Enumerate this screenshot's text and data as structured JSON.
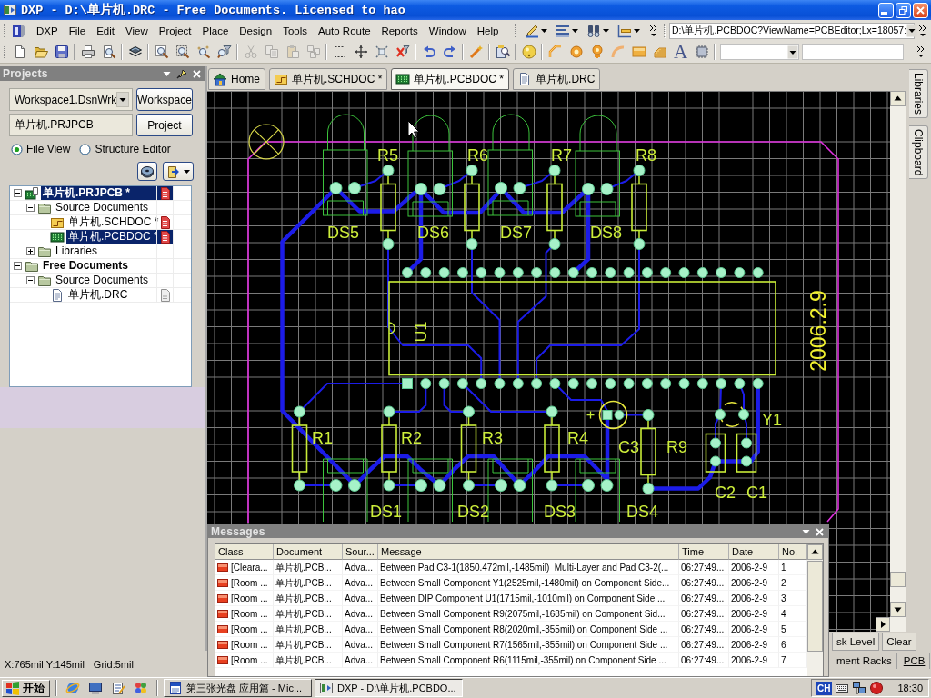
{
  "window": {
    "title": "DXP - D:\\单片机.DRC - Free Documents. Licensed to hao"
  },
  "menu_bar": {
    "items": [
      "DXP",
      "File",
      "Edit",
      "View",
      "Project",
      "Place",
      "Design",
      "Tools",
      "Auto Route",
      "Reports",
      "Window",
      "Help"
    ],
    "address": "D:\\单片机.PCBDOC?ViewName=PCBEditor;Lx=18057:"
  },
  "toolbar": {
    "clipboard_tools": [
      {
        "disabled": true
      },
      {
        "disabled": true
      },
      {
        "disabled": true
      },
      {
        "disabled": true
      }
    ],
    "text_tool": "A"
  },
  "projects_panel": {
    "title": "Projects",
    "workspace": {
      "value": "Workspace1.DsnWrk",
      "button": "Workspace"
    },
    "project": {
      "value": "单片机.PRJPCB",
      "button": "Project"
    },
    "view_options": [
      {
        "label": "File View",
        "selected": true
      },
      {
        "label": "Structure Editor",
        "selected": false
      }
    ],
    "tree": [
      {
        "label": "单片机.PRJPCB *",
        "kind": "project",
        "expanded": true,
        "selected": true,
        "modified": true,
        "children": [
          {
            "label": "Source Documents",
            "kind": "folder",
            "expanded": true,
            "selected": false,
            "children": [
              {
                "label": "单片机.SCHDOC *",
                "kind": "schematic",
                "selected": false,
                "modified": true
              },
              {
                "label": "单片机.PCBDOC *",
                "kind": "pcb",
                "selected": true,
                "modified": true
              }
            ]
          },
          {
            "label": "Libraries",
            "kind": "folder",
            "expanded": false,
            "selected": false
          }
        ]
      },
      {
        "label": "Free Documents",
        "kind": "group",
        "expanded": true,
        "selected": false,
        "children": [
          {
            "label": "Source Documents",
            "kind": "folder",
            "expanded": true,
            "selected": false,
            "children": [
              {
                "label": "单片机.DRC",
                "kind": "report",
                "selected": false,
                "modified": false
              }
            ]
          }
        ]
      }
    ]
  },
  "document_tabs": [
    {
      "label": "Home",
      "kind": "home",
      "selected": false
    },
    {
      "label": "单片机.SCHDOC *",
      "kind": "schematic",
      "selected": false
    },
    {
      "label": "单片机.PCBDOC *",
      "kind": "pcb",
      "selected": true
    },
    {
      "label": "单片机.DRC",
      "kind": "report",
      "selected": false
    }
  ],
  "side_tabs": [
    "Libraries",
    "Clipboard"
  ],
  "pcb": {
    "components": [
      {
        "designator": "R5",
        "kind": "resistor"
      },
      {
        "designator": "R6",
        "kind": "resistor"
      },
      {
        "designator": "R7",
        "kind": "resistor"
      },
      {
        "designator": "R8",
        "kind": "resistor"
      },
      {
        "designator": "DS5",
        "kind": "led"
      },
      {
        "designator": "DS6",
        "kind": "led"
      },
      {
        "designator": "DS7",
        "kind": "led"
      },
      {
        "designator": "DS8",
        "kind": "led"
      },
      {
        "designator": "U1",
        "kind": "dip"
      },
      {
        "designator": "R1",
        "kind": "resistor"
      },
      {
        "designator": "R2",
        "kind": "resistor"
      },
      {
        "designator": "R3",
        "kind": "resistor"
      },
      {
        "designator": "R4",
        "kind": "resistor"
      },
      {
        "designator": "C3",
        "kind": "polarized_capacitor"
      },
      {
        "designator": "R9",
        "kind": "resistor"
      },
      {
        "designator": "Y1",
        "kind": "crystal"
      },
      {
        "designator": "C2",
        "kind": "capacitor"
      },
      {
        "designator": "C1",
        "kind": "capacitor"
      },
      {
        "designator": "DS1",
        "kind": "led"
      },
      {
        "designator": "DS2",
        "kind": "led"
      },
      {
        "designator": "DS3",
        "kind": "led"
      },
      {
        "designator": "DS4",
        "kind": "led"
      }
    ],
    "date_text": "2006.2.9"
  },
  "messages_panel": {
    "title": "Messages",
    "columns": [
      "Class",
      "Document",
      "Sour...",
      "Message",
      "Time",
      "Date",
      "No."
    ],
    "rows": [
      [
        "[Cleara...",
        "单片机.PCB...",
        "Adva...",
        "Between Pad C3-1(1850.472mil,-1485mil)  Multi-Layer and Pad C3-2(...",
        "06:27:49...",
        "2006-2-9",
        "1"
      ],
      [
        "[Room ...",
        "单片机.PCB...",
        "Adva...",
        "Between Small Component Y1(2525mil,-1480mil) on Component Side...",
        "06:27:49...",
        "2006-2-9",
        "2"
      ],
      [
        "[Room ...",
        "单片机.PCB...",
        "Adva...",
        "Between DIP Component U1(1715mil,-1010mil) on Component Side ...",
        "06:27:49...",
        "2006-2-9",
        "3"
      ],
      [
        "[Room ...",
        "单片机.PCB...",
        "Adva...",
        "Between Small Component R9(2075mil,-1685mil) on Component Sid...",
        "06:27:49...",
        "2006-2-9",
        "4"
      ],
      [
        "[Room ...",
        "单片机.PCB...",
        "Adva...",
        "Between Small Component R8(2020mil,-355mil) on Component Side ...",
        "06:27:49...",
        "2006-2-9",
        "5"
      ],
      [
        "[Room ...",
        "单片机.PCB...",
        "Adva...",
        "Between Small Component R7(1565mil,-355mil) on Component Side ...",
        "06:27:49...",
        "2006-2-9",
        "6"
      ],
      [
        "[Room ...",
        "单片机.PCB...",
        "Adva...",
        "Between Small Component R6(1115mil,-355mil) on Component Side ...",
        "06:27:49...",
        "2006-2-9",
        "7"
      ]
    ]
  },
  "panel_buttons": [
    "sk Level",
    "Clear"
  ],
  "panel_tabs": [
    {
      "label": "ment Racks",
      "selected": false
    },
    {
      "label": "PCB",
      "selected": true
    }
  ],
  "status_bar": {
    "position": "X:765mil Y:145mil",
    "grid": "Grid:5mil"
  },
  "taskbar": {
    "start_button": "开始",
    "tasks": [
      {
        "label": "第三张光盘 应用篇 - Mic...",
        "kind": "document",
        "selected": false
      },
      {
        "label": "DXP - D:\\单片机.PCBDO...",
        "kind": "app",
        "selected": true
      }
    ],
    "language": "CH",
    "clock": "18:30"
  }
}
